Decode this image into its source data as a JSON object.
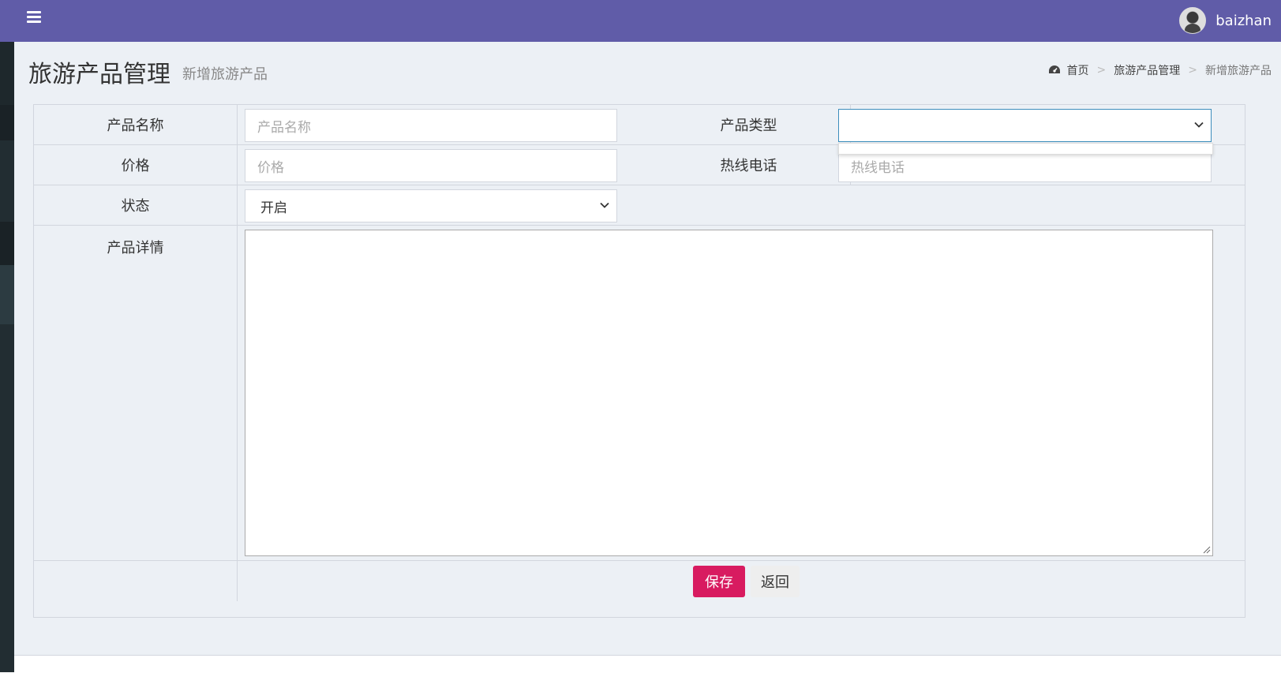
{
  "header": {
    "username": "baizhan",
    "menu_icon": "hamburger-icon",
    "avatar_icon": "user-avatar"
  },
  "page": {
    "title": "旅游产品管理",
    "subtitle": "新增旅游产品"
  },
  "breadcrumb": {
    "icon": "dashboard-icon",
    "items": [
      "首页",
      "旅游产品管理",
      "新增旅游产品"
    ],
    "separator": ">"
  },
  "form": {
    "product_name": {
      "label": "产品名称",
      "placeholder": "产品名称",
      "value": ""
    },
    "product_type": {
      "label": "产品类型",
      "value": ""
    },
    "price": {
      "label": "价格",
      "placeholder": "价格",
      "value": ""
    },
    "hotline": {
      "label": "热线电话",
      "placeholder": "热线电话",
      "value": ""
    },
    "status": {
      "label": "状态",
      "value": "开启"
    },
    "detail": {
      "label": "产品详情",
      "value": ""
    }
  },
  "actions": {
    "save_label": "保存",
    "back_label": "返回"
  },
  "colors": {
    "topbar": "#605ca8",
    "sidebar": "#222d32",
    "content_bg": "#ecf0f5",
    "save_button": "#d81b60",
    "focus_border": "#3c8dbc"
  }
}
